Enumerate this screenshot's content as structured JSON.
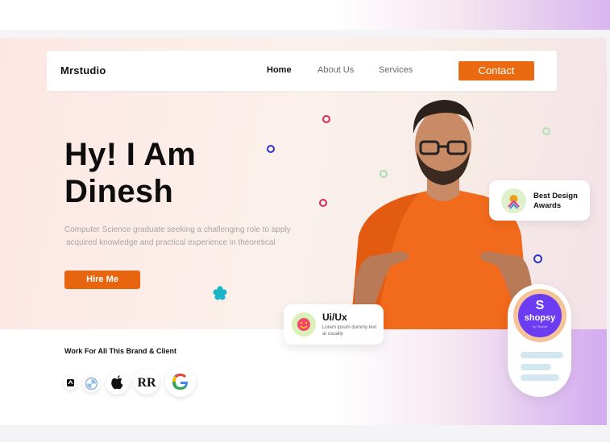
{
  "navbar": {
    "logo": "Mrstudio",
    "links": [
      "Home",
      "About Us",
      "Services"
    ],
    "active": "Home",
    "contact_label": "Contact"
  },
  "hero": {
    "headline_line1": "Hy! I Am",
    "headline_line2": "Dinesh",
    "description_line1": "Computer Science graduate seeking a challenging role to apply",
    "description_line2": "acquired knowledge and practical experience in theoretical",
    "hire_label": "Hire Me"
  },
  "cards": {
    "award_label": "Best Design Awards",
    "uiux_title": "Ui/Ux",
    "uiux_desc": "Lorem ipsum dummy text ar usually"
  },
  "shopsy": {
    "letter": "S",
    "name": "shopsy",
    "sub": "by Flipkart"
  },
  "brands": {
    "title": "Work For All This Brand & Client",
    "items": [
      "amazon-icon",
      "bmw-icon",
      "apple-icon",
      "rolls-royce-icon",
      "google-icon"
    ]
  },
  "colors": {
    "accent": "#ea6a12",
    "shopsy": "#6b3cf2",
    "text_dark": "#111111"
  }
}
